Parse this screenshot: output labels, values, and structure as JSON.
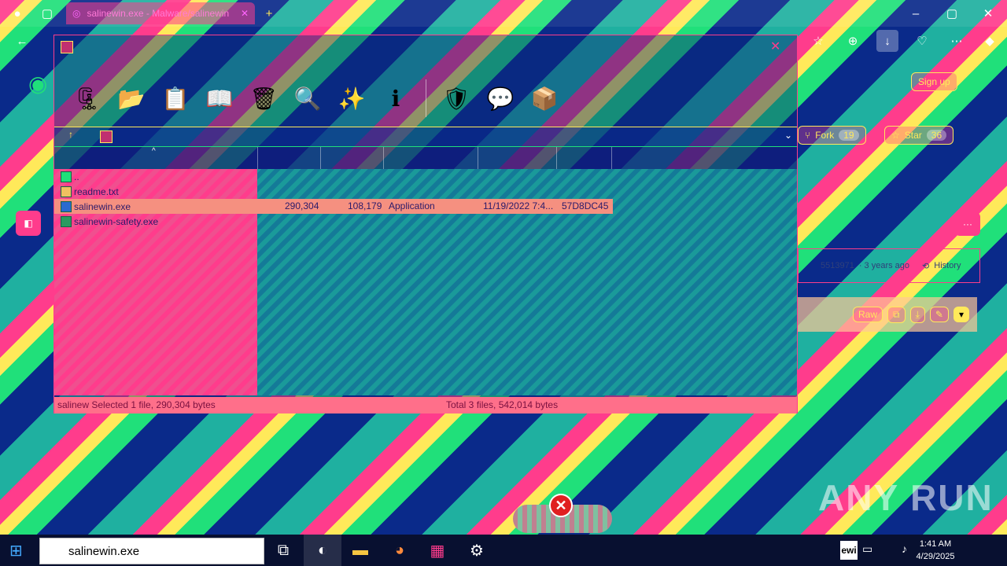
{
  "browser": {
    "tab_title": "salinewin.exe - Malware/salinewin",
    "new_tab": "+"
  },
  "webpage": {
    "sign_up": "Sign up",
    "fork_label": "Fork",
    "fork_count": "19",
    "star_label": "Star",
    "star_count": "36",
    "commit_hash": "5513971",
    "commit_age": "· 3 years ago",
    "history_label": "History",
    "raw_label": "Raw"
  },
  "rar": {
    "address_path": "",
    "toolbar_icons": [
      "add-icon",
      "extract-icon",
      "test-icon",
      "view-icon",
      "delete-icon",
      "find-icon",
      "wizard-icon",
      "info-icon",
      "virus-scan-icon",
      "comment-icon",
      "sfx-icon"
    ],
    "files": [
      {
        "name": "..",
        "size": "",
        "packed": "",
        "type": "",
        "modified": "",
        "crc": ""
      },
      {
        "name": "readme.txt",
        "size": "",
        "packed": "",
        "type": "",
        "modified": "",
        "crc": ""
      },
      {
        "name": "salinewin.exe",
        "size": "290,304",
        "packed": "108,179",
        "type": "Application",
        "modified": "11/19/2022 7:4...",
        "crc": "57D8DC45"
      },
      {
        "name": "salinewin-safety.exe",
        "size": "",
        "packed": "",
        "type": "",
        "modified": "",
        "crc": ""
      }
    ],
    "status_left": "salinew Selected 1 file, 290,304 bytes",
    "status_right": "Total 3 files, 542,014 bytes"
  },
  "taskbar": {
    "search_value": "salinewin.exe",
    "time": "1:41 AM",
    "date": "4/29/2025",
    "tray_label": "ewi"
  },
  "watermark": "ANY RUN"
}
